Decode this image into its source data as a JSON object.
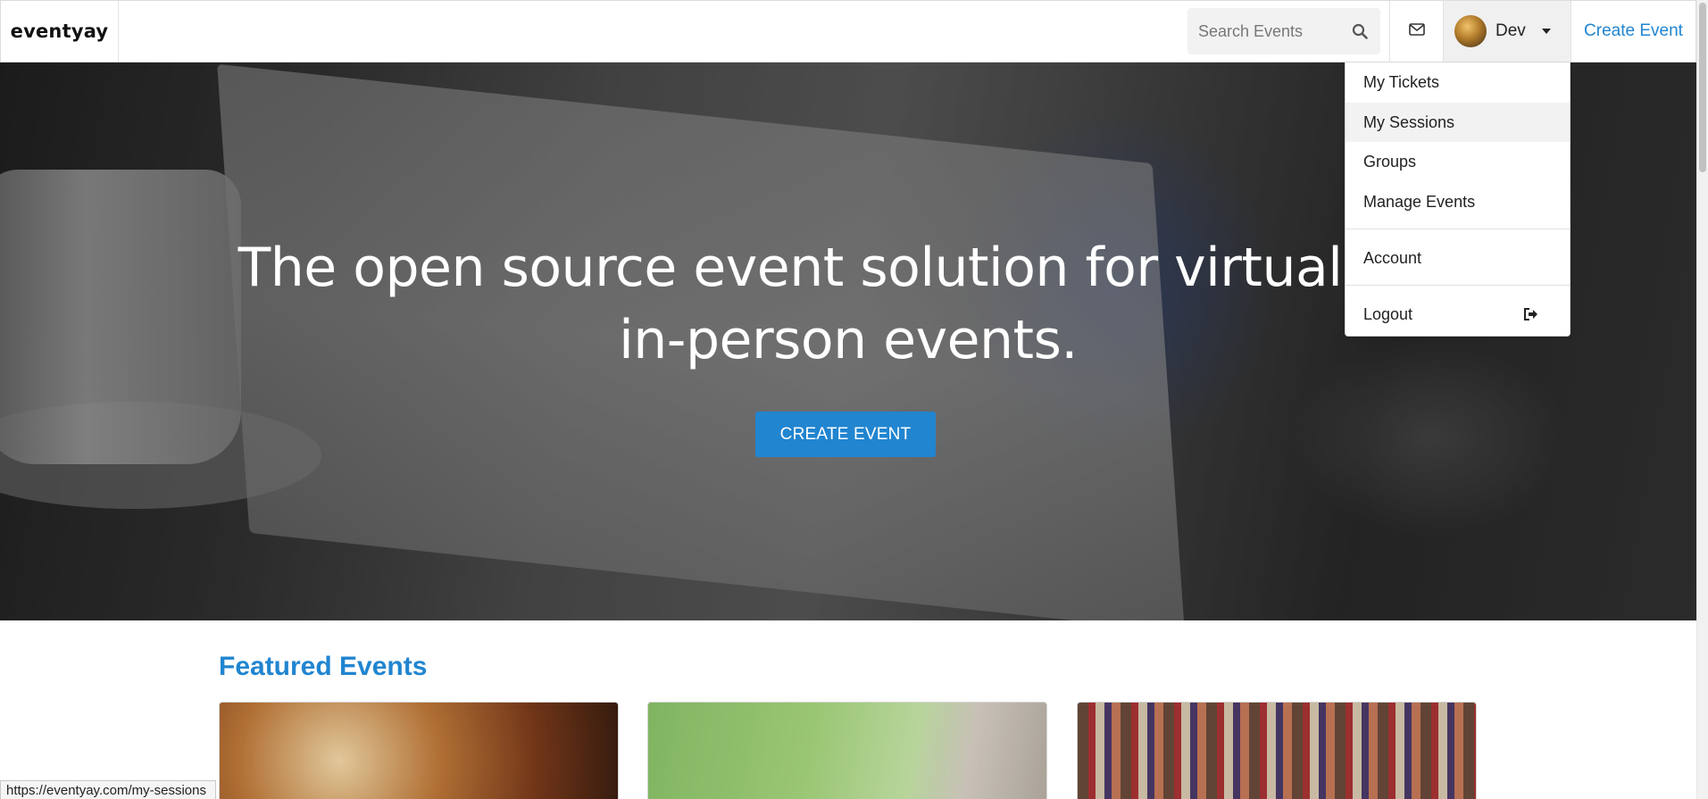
{
  "navbar": {
    "brand": "eventyay",
    "search": {
      "placeholder": "Search Events",
      "value": ""
    },
    "user_name": "Dev",
    "create_event_link": "Create Event"
  },
  "hero": {
    "title": "The open source event solution for virtual and in-person events.",
    "cta_label": "CREATE EVENT"
  },
  "featured": {
    "title": "Featured Events"
  },
  "user_menu": {
    "items": [
      {
        "label": "My Tickets"
      },
      {
        "label": "My Sessions"
      },
      {
        "label": "Groups"
      },
      {
        "label": "Manage Events"
      },
      {
        "label": "Account"
      },
      {
        "label": "Logout"
      }
    ],
    "highlighted": "My Sessions"
  },
  "status_bar": {
    "url": "https://eventyay.com/my-sessions"
  },
  "colors": {
    "accent": "#2185d0",
    "menu_highlight": "#f2f2f2"
  },
  "icons": [
    "search-icon",
    "mail-icon",
    "avatar",
    "caret-down-icon",
    "logout-icon"
  ]
}
